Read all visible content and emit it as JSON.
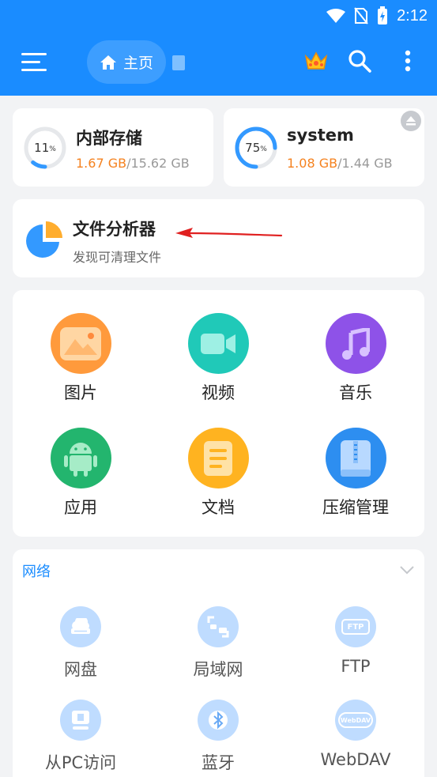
{
  "status_bar": {
    "time": "2:12"
  },
  "appbar": {
    "home_tab_label": "主页",
    "icons": [
      "menu-icon",
      "home-icon",
      "document-icon",
      "crown-icon",
      "search-icon",
      "more-vert-icon"
    ]
  },
  "storage": [
    {
      "title": "内部存储",
      "percent": 11,
      "percent_text": "11",
      "percent_unit": "%",
      "used": "1.67 GB",
      "total": "/15.62 GB"
    },
    {
      "title": "system",
      "percent": 75,
      "percent_text": "75",
      "percent_unit": "%",
      "used": "1.08 GB",
      "total": "/1.44 GB"
    }
  ],
  "analyzer": {
    "title": "文件分析器",
    "subtitle": "发现可清理文件"
  },
  "categories": [
    {
      "label": "图片",
      "icon": "image-icon",
      "color": "#ff9a3c"
    },
    {
      "label": "视频",
      "icon": "video-icon",
      "color": "#20c9b8"
    },
    {
      "label": "音乐",
      "icon": "music-icon",
      "color": "#8e52e8"
    },
    {
      "label": "应用",
      "icon": "android-icon",
      "color": "#23b56e"
    },
    {
      "label": "文档",
      "icon": "document-icon",
      "color": "#ffb320"
    },
    {
      "label": "压缩管理",
      "icon": "archive-icon",
      "color": "#2d8ef0"
    }
  ],
  "network": {
    "title": "网络",
    "items": [
      {
        "label": "网盘",
        "icon": "cloud-drive-icon"
      },
      {
        "label": "局域网",
        "icon": "lan-icon"
      },
      {
        "label": "FTP",
        "icon": "ftp-icon",
        "badge": "FTP"
      },
      {
        "label": "从PC访问",
        "icon": "pc-access-icon"
      },
      {
        "label": "蓝牙",
        "icon": "bluetooth-icon"
      },
      {
        "label": "WebDAV",
        "icon": "webdav-icon",
        "badge": "WebDAV"
      }
    ]
  },
  "colors": {
    "primary": "#1a8cff",
    "accent_orange": "#f5821f",
    "ring_blue": "#3399ff"
  }
}
